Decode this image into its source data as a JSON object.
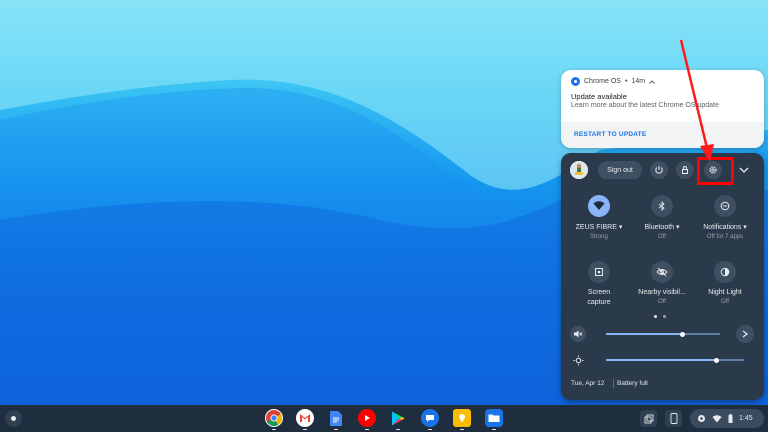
{
  "notification": {
    "app": "Chrome OS",
    "time": "14m",
    "title": "Update available",
    "body": "Learn more about the latest Chrome OS update",
    "action": "RESTART TO UPDATE"
  },
  "quick_settings": {
    "sign_out": "Sign out",
    "tiles": [
      {
        "label": "ZEUS FIBRE",
        "sub": "Strong"
      },
      {
        "label": "Bluetooth",
        "sub": "Off"
      },
      {
        "label": "Notifications",
        "sub": "Off for 7 apps"
      },
      {
        "label": "Screen",
        "label2": "capture"
      },
      {
        "label": "Nearby visibil...",
        "sub": "Off"
      },
      {
        "label": "Night Light",
        "sub": "Off"
      }
    ],
    "volume_level": 0.67,
    "brightness_level": 0.8,
    "date": "Tue, Apr 12",
    "battery": "Battery full"
  },
  "shelf": {
    "time": "1:45",
    "apps": [
      "chrome",
      "gmail",
      "docs",
      "youtube",
      "play-store",
      "messages",
      "keep",
      "files"
    ]
  },
  "colors": {
    "accent": "#8ab4f8",
    "panel": "#2a3a4b",
    "highlight": "#ff0000",
    "shelf": "#1e2e3e"
  }
}
